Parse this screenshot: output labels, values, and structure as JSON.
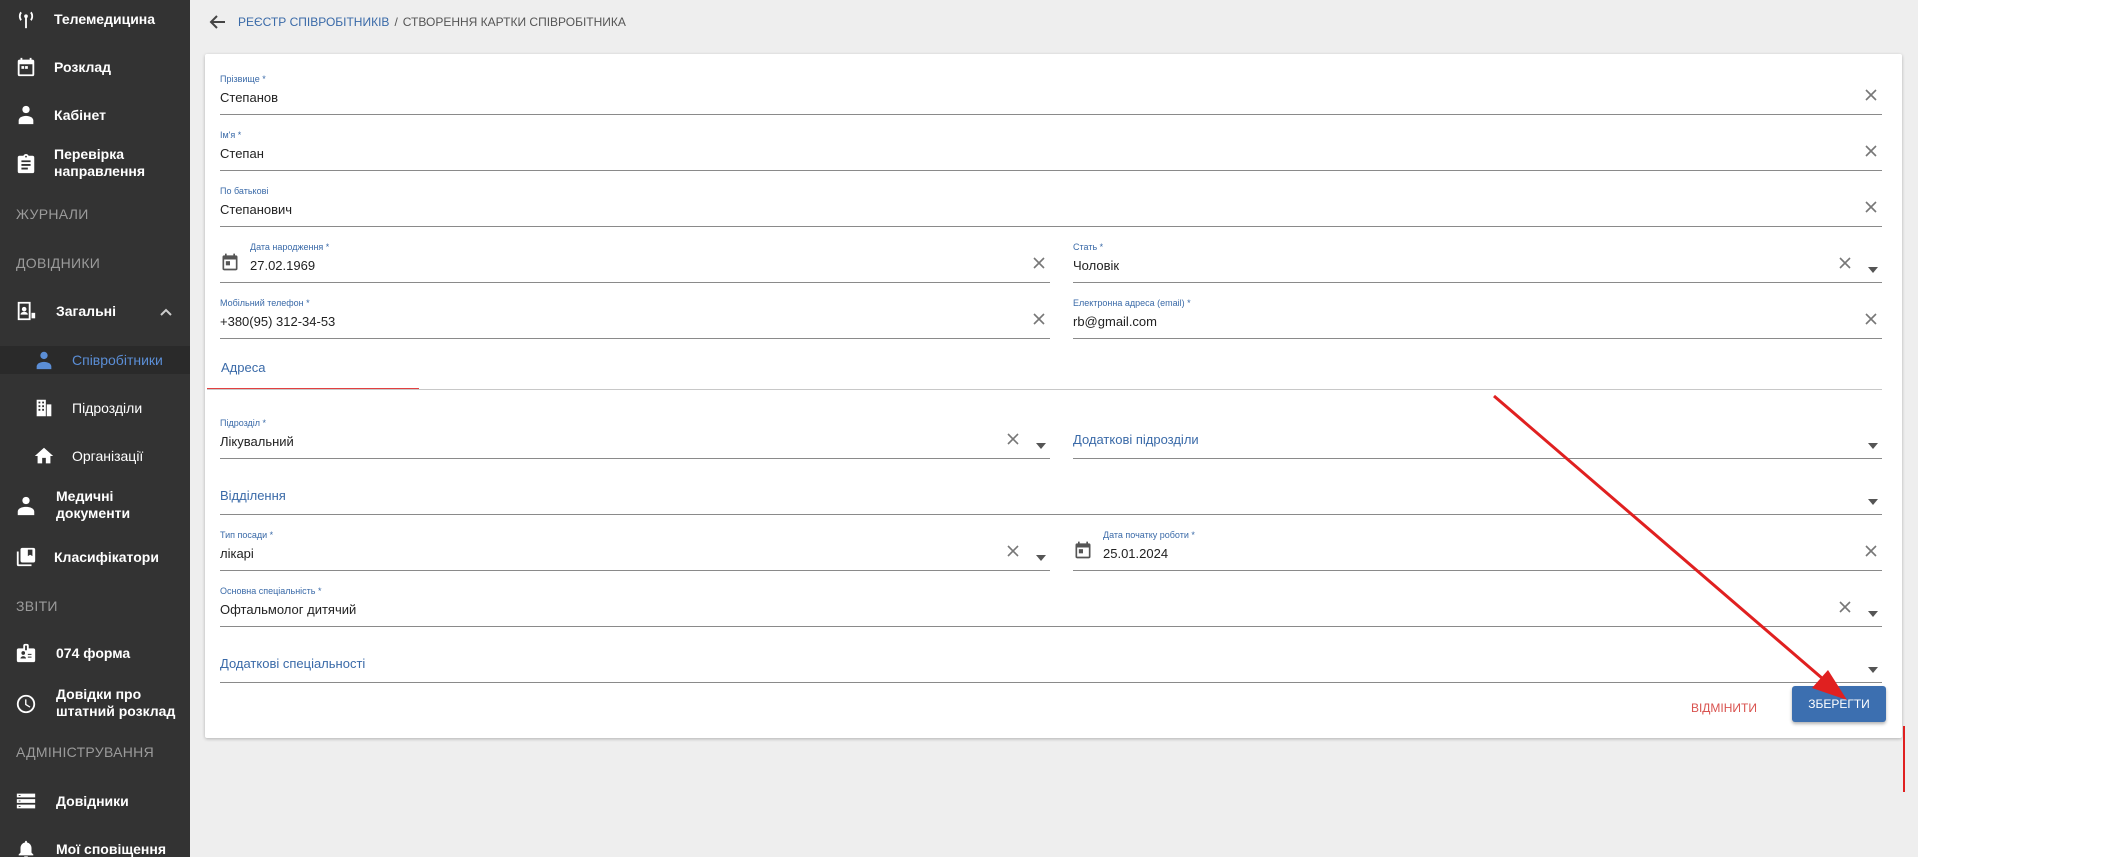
{
  "sidebar": {
    "items": [
      {
        "label": "Телемедицина",
        "icon": "antenna-icon"
      },
      {
        "label": "Розклад",
        "icon": "calendar-icon"
      },
      {
        "label": "Кабінет",
        "icon": "doctor-icon"
      },
      {
        "label": "Перевірка\nнаправлення",
        "icon": "clipboard-icon"
      }
    ],
    "sections": {
      "journals": "ЖУРНАЛИ",
      "references": "ДОВІДНИКИ",
      "reports": "ЗВІТИ",
      "admin": "АДМІНІСТРУВАННЯ"
    },
    "general": {
      "label": "Загальні",
      "icon": "id-card-icon"
    },
    "sub_items": [
      {
        "label": "Співробітники",
        "icon": "staff-icon"
      },
      {
        "label": "Підрозділи",
        "icon": "building-icon"
      },
      {
        "label": "Організації",
        "icon": "home-icon"
      }
    ],
    "med_docs": {
      "label": "Медичні\nдокументи",
      "icon": "med-docs-icon"
    },
    "classifiers": {
      "label": "Класифікатори",
      "icon": "library-icon"
    },
    "form074": {
      "label": "074 форма",
      "icon": "badge-icon"
    },
    "staff_schedule": {
      "label": "Довідки про\nштатний розклад",
      "icon": "clock-icon"
    },
    "directories": {
      "label": "Довідники",
      "icon": "storage-icon"
    },
    "notifications": {
      "label": "Мої сповіщення",
      "icon": "bell-icon"
    }
  },
  "breadcrumb": {
    "link": "РЕЄСТР СПІВРОБІТНИКІВ",
    "separator": "/",
    "current": "СТВОРЕННЯ КАРТКИ СПІВРОБІТНИКА"
  },
  "form": {
    "surname": {
      "label": "Прізвище *",
      "value": "Степанов"
    },
    "name": {
      "label": "Ім'я *",
      "value": "Степан"
    },
    "patronymic": {
      "label": "По батькові",
      "value": "Степанович"
    },
    "birth_date": {
      "label": "Дата народження *",
      "value": "27.02.1969"
    },
    "gender": {
      "label": "Стать *",
      "value": "Чоловік"
    },
    "phone": {
      "label": "Мобільний телефон *",
      "value": "+380(95) 312-34-53"
    },
    "email": {
      "label": "Електронна адреса (email) *",
      "value": "rb@gmail.com"
    },
    "address_tab": "Адреса",
    "division": {
      "label": "Підрозділ *",
      "value": "Лікувальний"
    },
    "extra_divisions": {
      "placeholder": "Додаткові підрозділи"
    },
    "department": {
      "placeholder": "Відділення"
    },
    "position_type": {
      "label": "Тип посади *",
      "value": "лікарі"
    },
    "start_date": {
      "label": "Дата початку роботи *",
      "value": "25.01.2024"
    },
    "main_specialty": {
      "label": "Основна спеціальність *",
      "value": "Офтальмолог дитячий"
    },
    "extra_specialties": {
      "placeholder": "Додаткові спеціальності"
    }
  },
  "actions": {
    "cancel": "ВІДМІНИТИ",
    "save": "ЗБЕРЕГТИ"
  },
  "colors": {
    "sidebar_bg": "#333333",
    "accent": "#3c6fb0",
    "cancel": "#d9534f",
    "annotation_arrow": "#e02020"
  }
}
